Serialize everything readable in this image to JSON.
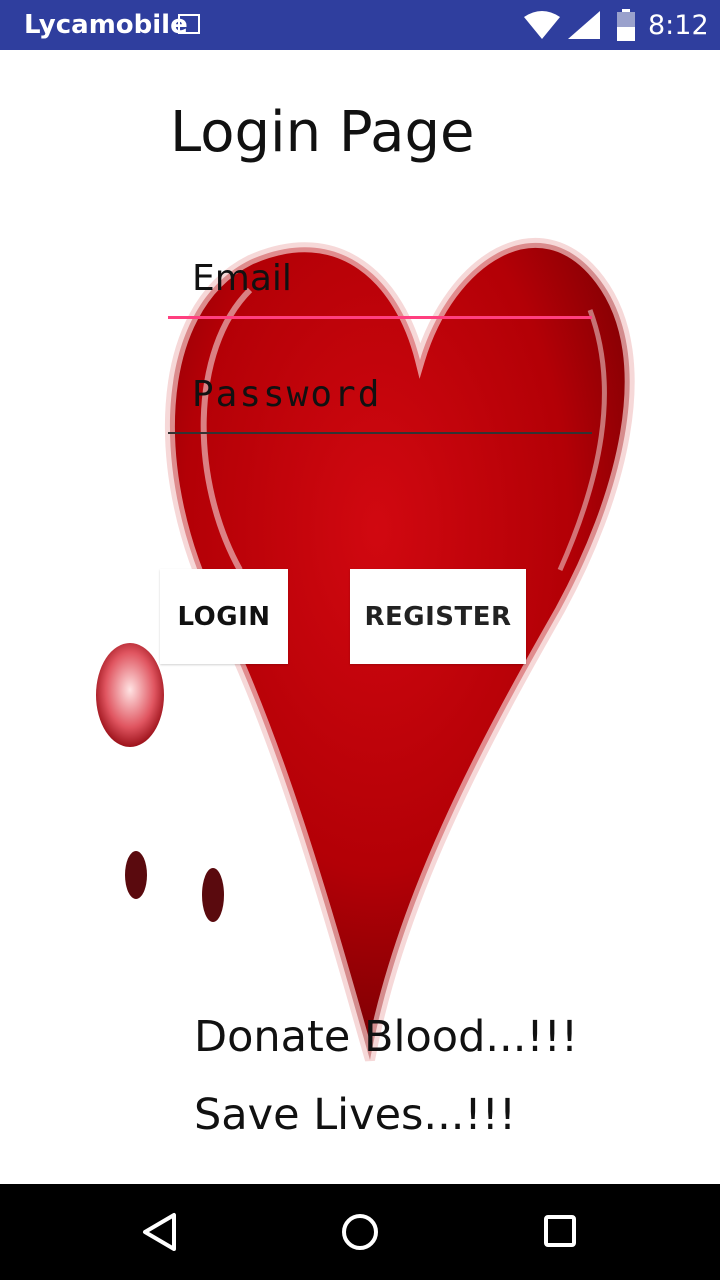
{
  "status_bar": {
    "carrier": "Lycamobile",
    "time": "8:12",
    "icons": [
      "gallery-icon",
      "wifi-icon",
      "signal-icon",
      "battery-icon"
    ]
  },
  "login": {
    "title": "Login Page",
    "email_placeholder": "Email",
    "password_placeholder": "Password",
    "login_label": "LOGIN",
    "register_label": "REGISTER"
  },
  "tagline": {
    "line1": "Donate Blood...!!!",
    "line2": "Save Lives...!!!"
  },
  "colors": {
    "status_bar": "#2f3e9e",
    "email_underline": "#ff3f7f",
    "heart": "#b80008"
  },
  "nav_bar": {
    "icons": [
      "back-icon",
      "home-icon",
      "recents-icon"
    ]
  }
}
